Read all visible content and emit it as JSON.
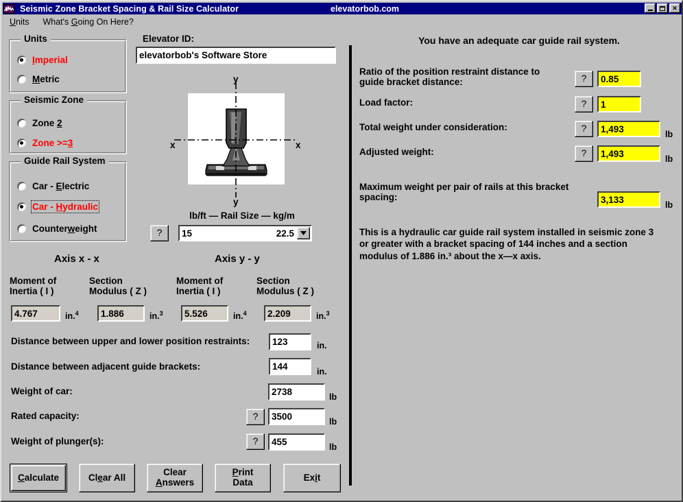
{
  "window": {
    "title": "Seismic Zone Bracket Spacing & Rail Size Calculator",
    "subtitle": "elevatorbob.com",
    "icon": "seismograph-icon",
    "minimize_label": "_",
    "maximize_label": "□",
    "close_label": "✕"
  },
  "menu": {
    "items": [
      {
        "pre": "",
        "accel": "U",
        "post": "nits"
      },
      {
        "pre": "What's ",
        "accel": "G",
        "post": "oing On Here?"
      }
    ]
  },
  "units_group": {
    "title": "Units",
    "options": [
      {
        "pre": "",
        "accel": "I",
        "post": "mperial",
        "selected": true
      },
      {
        "pre": "",
        "accel": "M",
        "post": "etric",
        "selected": false
      }
    ]
  },
  "seismic_group": {
    "title": "Seismic Zone",
    "options": [
      {
        "pre": "Zone ",
        "accel": "2",
        "post": "",
        "selected": false
      },
      {
        "pre": "Zone >=",
        "accel": "3",
        "post": "",
        "selected": true
      }
    ]
  },
  "rail_system_group": {
    "title": "Guide Rail System",
    "options": [
      {
        "pre": "Car - ",
        "accel": "E",
        "post": "lectric",
        "selected": false
      },
      {
        "pre": "Car - ",
        "accel": "H",
        "post": "ydraulic",
        "selected": true,
        "focused": true
      },
      {
        "pre": "Counter",
        "accel": "w",
        "post": "eight",
        "selected": false
      }
    ]
  },
  "elevator_id": {
    "label": "Elevator ID:",
    "value": "elevatorbob's Software Store",
    "placeholder": "Elevator ID"
  },
  "diagram": {
    "y_top_label": "y",
    "y_bottom_label": "y",
    "x_left_label": "x",
    "x_right_label": "x",
    "alt": "guide rail cross section"
  },
  "rail_size": {
    "header": "lb/ft — Rail Size — kg/m",
    "help_label": "?",
    "value_left": "15",
    "value_right": "22.5",
    "options": [
      "15        22.5"
    ]
  },
  "axes": {
    "x_title": "Axis x - x",
    "y_title": "Axis y - y",
    "columns": [
      {
        "label_line1": "Moment of",
        "label_line2": "Inertia ( I )",
        "value": "4.767",
        "unit": "in.",
        "exp": "4"
      },
      {
        "label_line1": "Section",
        "label_line2": "Modulus ( Z )",
        "value": "1.886",
        "unit": "in.",
        "exp": "3"
      },
      {
        "label_line1": "Moment of",
        "label_line2": "Inertia ( I )",
        "value": "5.526",
        "unit": "in.",
        "exp": "4"
      },
      {
        "label_line1": "Section",
        "label_line2": "Modulus ( Z )",
        "value": "2.209",
        "unit": "in.",
        "exp": "3"
      }
    ]
  },
  "inputs": [
    {
      "label": "Distance between upper and lower position restraints:",
      "value": "123",
      "unit": "in.",
      "help": false
    },
    {
      "label": "Distance between adjacent guide brackets:",
      "value": "144",
      "unit": "in.",
      "help": false
    },
    {
      "label": "Weight of car:",
      "value": "2738",
      "unit": "lb",
      "help": false
    },
    {
      "label": "Rated capacity:",
      "value": "3500",
      "unit": "lb",
      "help": true,
      "help_label": "?"
    },
    {
      "label": "Weight of plunger(s):",
      "value": "455",
      "unit": "lb",
      "help": true,
      "help_label": "?"
    }
  ],
  "actions": [
    {
      "pre": "",
      "accel": "C",
      "post": "alculate",
      "default": true
    },
    {
      "pre": "Cl",
      "accel": "e",
      "post": "ar All",
      "default": false
    },
    {
      "line1": "Clear",
      "pre2": "",
      "accel": "A",
      "post2": "nswers",
      "default": false
    },
    {
      "pre": "",
      "accel": "P",
      "post": "rint",
      "line2": "Data",
      "default": false
    },
    {
      "pre": "Ex",
      "accel": "i",
      "post": "t",
      "default": false
    }
  ],
  "results": {
    "headline": "You have an adequate car guide rail system.",
    "rows": [
      {
        "label_line1": "Ratio of the position restraint distance to",
        "label_line2": "guide bracket distance:",
        "help_label": "?",
        "value": "0.85",
        "unit": ""
      },
      {
        "label_line1": "Load factor:",
        "label_line2": "",
        "help_label": "?",
        "value": "1",
        "unit": ""
      },
      {
        "label_line1": "Total weight under consideration:",
        "label_line2": "",
        "help_label": "?",
        "value": "1,493",
        "unit": "lb"
      },
      {
        "label_line1": "Adjusted weight:",
        "label_line2": "",
        "help_label": "?",
        "value": "1,493",
        "unit": "lb"
      }
    ],
    "max_weight": {
      "label_line1": "Maximum weight per pair of rails at this bracket",
      "label_line2": "spacing:",
      "value": "3,133",
      "unit": "lb"
    },
    "summary_line1": "This is a hydraulic car guide rail system installed in seismic zone 3",
    "summary_line2": "or greater with a bracket spacing of 144 inches and a section",
    "summary_line3": "modulus of 1.886 in.³ about the x—x axis."
  }
}
